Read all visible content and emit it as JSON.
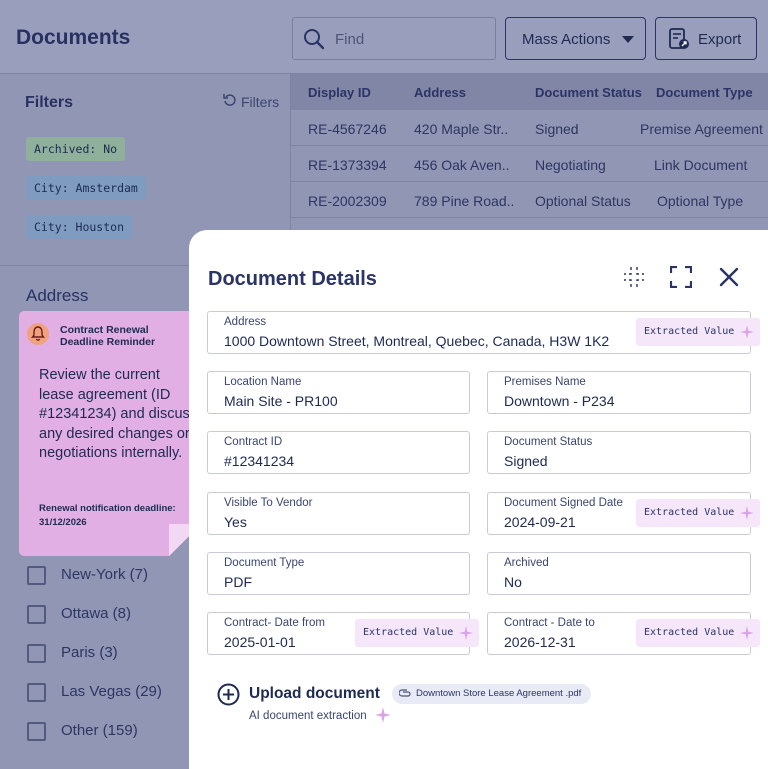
{
  "header": {
    "title": "Documents",
    "search_placeholder": "Find",
    "mass_actions_label": "Mass Actions",
    "export_label": "Export"
  },
  "filters": {
    "title": "Filters",
    "reset_label": "Filters",
    "chips": [
      "Archived: No",
      "City: Amsterdam",
      "City: Houston"
    ]
  },
  "table": {
    "columns": [
      "Display ID",
      "Address",
      "Document Status",
      "Document Type"
    ],
    "rows": [
      {
        "id": "RE-4567246",
        "address": "420 Maple Str..",
        "status": "Signed",
        "type": "Premise Agreement"
      },
      {
        "id": "RE-1373394",
        "address": "456 Oak Aven..",
        "status": "Negotiating",
        "type": "Link Document"
      },
      {
        "id": "RE-2002309",
        "address": "789 Pine Road..",
        "status": "Optional Status",
        "type": "Optional Type"
      }
    ]
  },
  "address_filter": {
    "title": "Address",
    "options": [
      "New-York (7)",
      "Ottawa (8)",
      "Paris (3)",
      "Las Vegas (29)",
      "Other (159)"
    ]
  },
  "reminder": {
    "title": "Contract  Renewal Deadline Reminder",
    "body": "Review the current lease agreement (ID #12341234) and discuss any desired changes or negotiations internally.",
    "footer": "Renewal notification deadline: 31/12/2026"
  },
  "details": {
    "title": "Document Details",
    "extracted_label": "Extracted Value",
    "fields": {
      "address": {
        "label": "Address",
        "value": "1000 Downtown Street, Montreal, Quebec, Canada, H3W 1K2"
      },
      "location_name": {
        "label": "Location Name",
        "value": "Main Site - PR100"
      },
      "premises_name": {
        "label": "Premises Name",
        "value": "Downtown - P234"
      },
      "contract_id": {
        "label": "Contract ID",
        "value": "#12341234"
      },
      "document_status": {
        "label": "Document Status",
        "value": "Signed"
      },
      "visible_to_vendor": {
        "label": "Visible To Vendor",
        "value": "Yes"
      },
      "signed_date": {
        "label": "Document  Signed Date",
        "value": "2024-09-21"
      },
      "document_type": {
        "label": "Document Type",
        "value": "PDF"
      },
      "archived": {
        "label": "Archived",
        "value": "No"
      },
      "date_from": {
        "label": "Contract- Date from",
        "value": "2025-01-01"
      },
      "date_to": {
        "label": "Contract - Date to",
        "value": "2026-12-31"
      }
    },
    "upload_label": "Upload document",
    "file_name": "Downtown Store Lease Agreement .pdf",
    "ai_label": "AI document extraction"
  },
  "colors": {
    "overlay": "#9296b5",
    "sticky": "#e1afe3",
    "accent": "#2a3466",
    "extract_bg": "#f5e6fa"
  }
}
